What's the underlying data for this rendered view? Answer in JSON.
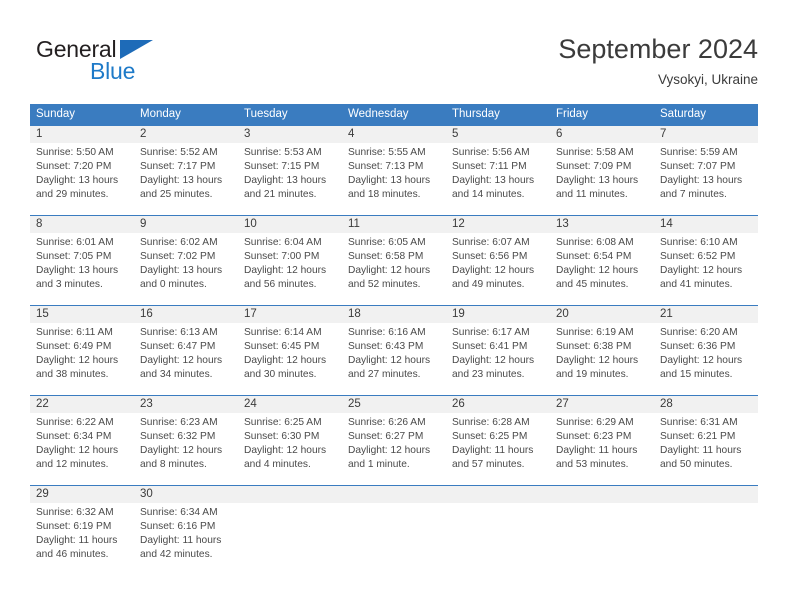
{
  "brand": {
    "name_part1": "General",
    "name_part2": "Blue",
    "accent_color": "#1e7ac8",
    "triangle_color": "#1e6bb8"
  },
  "header": {
    "month_title": "September 2024",
    "location": "Vysokyi, Ukraine"
  },
  "calendar": {
    "header_bg": "#3a7cc0",
    "day_num_bg": "#f1f1f1",
    "weekdays": [
      "Sunday",
      "Monday",
      "Tuesday",
      "Wednesday",
      "Thursday",
      "Friday",
      "Saturday"
    ],
    "weeks": [
      [
        {
          "day": "1",
          "sunrise": "Sunrise: 5:50 AM",
          "sunset": "Sunset: 7:20 PM",
          "daylight1": "Daylight: 13 hours",
          "daylight2": "and 29 minutes."
        },
        {
          "day": "2",
          "sunrise": "Sunrise: 5:52 AM",
          "sunset": "Sunset: 7:17 PM",
          "daylight1": "Daylight: 13 hours",
          "daylight2": "and 25 minutes."
        },
        {
          "day": "3",
          "sunrise": "Sunrise: 5:53 AM",
          "sunset": "Sunset: 7:15 PM",
          "daylight1": "Daylight: 13 hours",
          "daylight2": "and 21 minutes."
        },
        {
          "day": "4",
          "sunrise": "Sunrise: 5:55 AM",
          "sunset": "Sunset: 7:13 PM",
          "daylight1": "Daylight: 13 hours",
          "daylight2": "and 18 minutes."
        },
        {
          "day": "5",
          "sunrise": "Sunrise: 5:56 AM",
          "sunset": "Sunset: 7:11 PM",
          "daylight1": "Daylight: 13 hours",
          "daylight2": "and 14 minutes."
        },
        {
          "day": "6",
          "sunrise": "Sunrise: 5:58 AM",
          "sunset": "Sunset: 7:09 PM",
          "daylight1": "Daylight: 13 hours",
          "daylight2": "and 11 minutes."
        },
        {
          "day": "7",
          "sunrise": "Sunrise: 5:59 AM",
          "sunset": "Sunset: 7:07 PM",
          "daylight1": "Daylight: 13 hours",
          "daylight2": "and 7 minutes."
        }
      ],
      [
        {
          "day": "8",
          "sunrise": "Sunrise: 6:01 AM",
          "sunset": "Sunset: 7:05 PM",
          "daylight1": "Daylight: 13 hours",
          "daylight2": "and 3 minutes."
        },
        {
          "day": "9",
          "sunrise": "Sunrise: 6:02 AM",
          "sunset": "Sunset: 7:02 PM",
          "daylight1": "Daylight: 13 hours",
          "daylight2": "and 0 minutes."
        },
        {
          "day": "10",
          "sunrise": "Sunrise: 6:04 AM",
          "sunset": "Sunset: 7:00 PM",
          "daylight1": "Daylight: 12 hours",
          "daylight2": "and 56 minutes."
        },
        {
          "day": "11",
          "sunrise": "Sunrise: 6:05 AM",
          "sunset": "Sunset: 6:58 PM",
          "daylight1": "Daylight: 12 hours",
          "daylight2": "and 52 minutes."
        },
        {
          "day": "12",
          "sunrise": "Sunrise: 6:07 AM",
          "sunset": "Sunset: 6:56 PM",
          "daylight1": "Daylight: 12 hours",
          "daylight2": "and 49 minutes."
        },
        {
          "day": "13",
          "sunrise": "Sunrise: 6:08 AM",
          "sunset": "Sunset: 6:54 PM",
          "daylight1": "Daylight: 12 hours",
          "daylight2": "and 45 minutes."
        },
        {
          "day": "14",
          "sunrise": "Sunrise: 6:10 AM",
          "sunset": "Sunset: 6:52 PM",
          "daylight1": "Daylight: 12 hours",
          "daylight2": "and 41 minutes."
        }
      ],
      [
        {
          "day": "15",
          "sunrise": "Sunrise: 6:11 AM",
          "sunset": "Sunset: 6:49 PM",
          "daylight1": "Daylight: 12 hours",
          "daylight2": "and 38 minutes."
        },
        {
          "day": "16",
          "sunrise": "Sunrise: 6:13 AM",
          "sunset": "Sunset: 6:47 PM",
          "daylight1": "Daylight: 12 hours",
          "daylight2": "and 34 minutes."
        },
        {
          "day": "17",
          "sunrise": "Sunrise: 6:14 AM",
          "sunset": "Sunset: 6:45 PM",
          "daylight1": "Daylight: 12 hours",
          "daylight2": "and 30 minutes."
        },
        {
          "day": "18",
          "sunrise": "Sunrise: 6:16 AM",
          "sunset": "Sunset: 6:43 PM",
          "daylight1": "Daylight: 12 hours",
          "daylight2": "and 27 minutes."
        },
        {
          "day": "19",
          "sunrise": "Sunrise: 6:17 AM",
          "sunset": "Sunset: 6:41 PM",
          "daylight1": "Daylight: 12 hours",
          "daylight2": "and 23 minutes."
        },
        {
          "day": "20",
          "sunrise": "Sunrise: 6:19 AM",
          "sunset": "Sunset: 6:38 PM",
          "daylight1": "Daylight: 12 hours",
          "daylight2": "and 19 minutes."
        },
        {
          "day": "21",
          "sunrise": "Sunrise: 6:20 AM",
          "sunset": "Sunset: 6:36 PM",
          "daylight1": "Daylight: 12 hours",
          "daylight2": "and 15 minutes."
        }
      ],
      [
        {
          "day": "22",
          "sunrise": "Sunrise: 6:22 AM",
          "sunset": "Sunset: 6:34 PM",
          "daylight1": "Daylight: 12 hours",
          "daylight2": "and 12 minutes."
        },
        {
          "day": "23",
          "sunrise": "Sunrise: 6:23 AM",
          "sunset": "Sunset: 6:32 PM",
          "daylight1": "Daylight: 12 hours",
          "daylight2": "and 8 minutes."
        },
        {
          "day": "24",
          "sunrise": "Sunrise: 6:25 AM",
          "sunset": "Sunset: 6:30 PM",
          "daylight1": "Daylight: 12 hours",
          "daylight2": "and 4 minutes."
        },
        {
          "day": "25",
          "sunrise": "Sunrise: 6:26 AM",
          "sunset": "Sunset: 6:27 PM",
          "daylight1": "Daylight: 12 hours",
          "daylight2": "and 1 minute."
        },
        {
          "day": "26",
          "sunrise": "Sunrise: 6:28 AM",
          "sunset": "Sunset: 6:25 PM",
          "daylight1": "Daylight: 11 hours",
          "daylight2": "and 57 minutes."
        },
        {
          "day": "27",
          "sunrise": "Sunrise: 6:29 AM",
          "sunset": "Sunset: 6:23 PM",
          "daylight1": "Daylight: 11 hours",
          "daylight2": "and 53 minutes."
        },
        {
          "day": "28",
          "sunrise": "Sunrise: 6:31 AM",
          "sunset": "Sunset: 6:21 PM",
          "daylight1": "Daylight: 11 hours",
          "daylight2": "and 50 minutes."
        }
      ],
      [
        {
          "day": "29",
          "sunrise": "Sunrise: 6:32 AM",
          "sunset": "Sunset: 6:19 PM",
          "daylight1": "Daylight: 11 hours",
          "daylight2": "and 46 minutes."
        },
        {
          "day": "30",
          "sunrise": "Sunrise: 6:34 AM",
          "sunset": "Sunset: 6:16 PM",
          "daylight1": "Daylight: 11 hours",
          "daylight2": "and 42 minutes."
        },
        {
          "day": "",
          "sunrise": "",
          "sunset": "",
          "daylight1": "",
          "daylight2": ""
        },
        {
          "day": "",
          "sunrise": "",
          "sunset": "",
          "daylight1": "",
          "daylight2": ""
        },
        {
          "day": "",
          "sunrise": "",
          "sunset": "",
          "daylight1": "",
          "daylight2": ""
        },
        {
          "day": "",
          "sunrise": "",
          "sunset": "",
          "daylight1": "",
          "daylight2": ""
        },
        {
          "day": "",
          "sunrise": "",
          "sunset": "",
          "daylight1": "",
          "daylight2": ""
        }
      ]
    ]
  }
}
